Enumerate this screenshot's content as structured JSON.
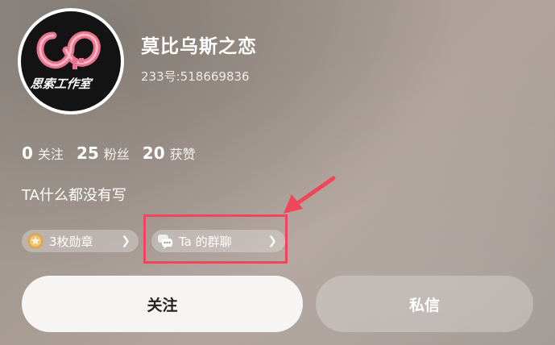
{
  "profile": {
    "name": "莫比乌斯之恋",
    "uid": "233号:518669836",
    "avatar_text": "思索工作室"
  },
  "stats": [
    {
      "value": "0",
      "label": "关注"
    },
    {
      "value": "25",
      "label": "粉丝"
    },
    {
      "value": "20",
      "label": "获赞"
    }
  ],
  "bio": "TA什么都没有写",
  "chips": {
    "badges_label": "3枚勋章",
    "groups_label": "Ta 的群聊"
  },
  "actions": {
    "follow_label": "关注",
    "message_label": "私信"
  },
  "icons": {
    "badge": "medal-icon",
    "groups": "chat-bubbles-icon",
    "chevron": "chevron-right-icon"
  },
  "colors": {
    "annotation": "#f0455a",
    "logo_pink": "#e8738e",
    "follow_button_bg": "#f7f5f4",
    "medal": "#d9a75a"
  }
}
